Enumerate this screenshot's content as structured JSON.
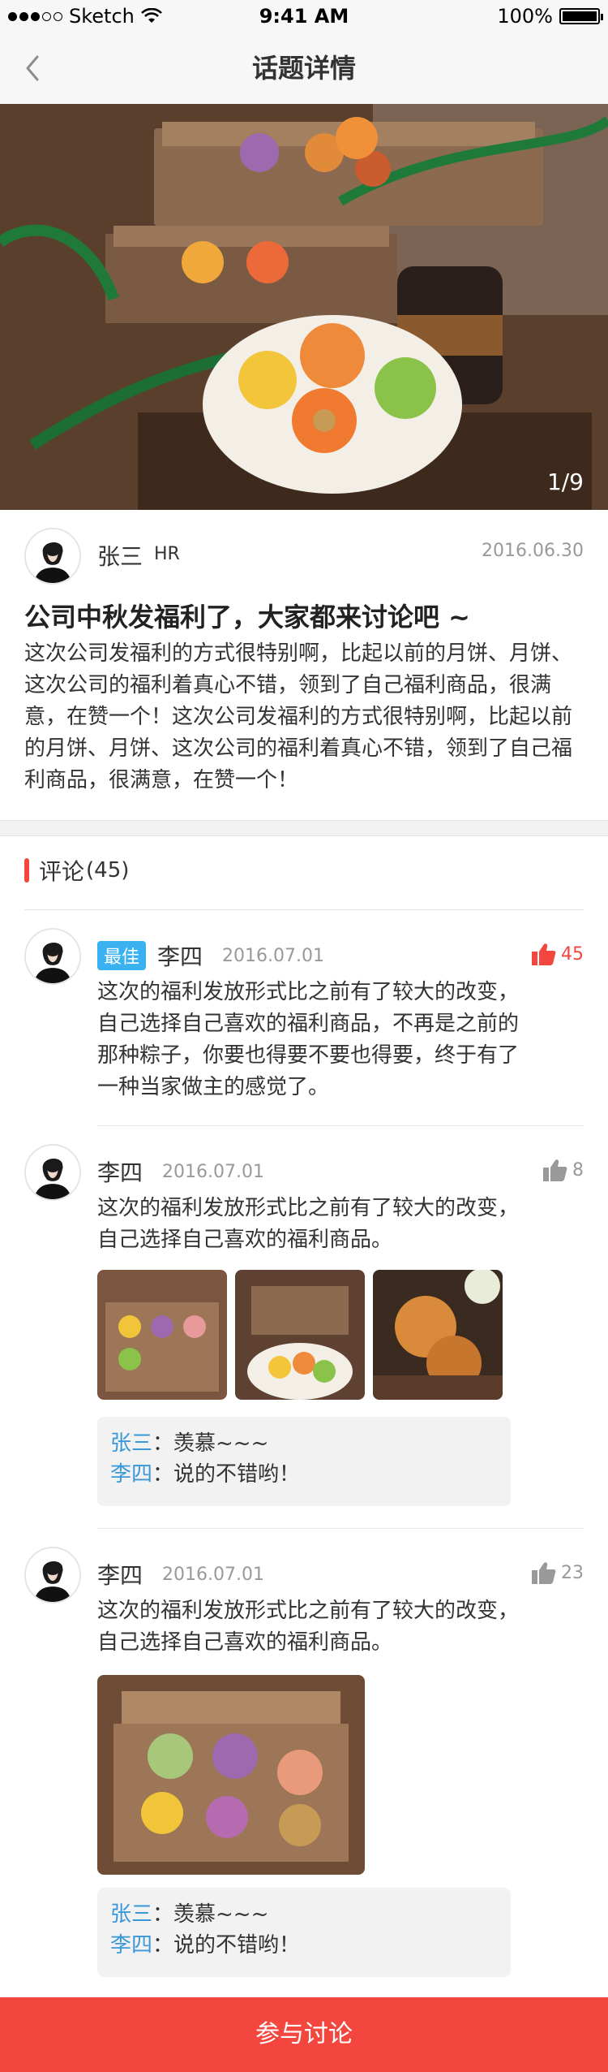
{
  "status_bar": {
    "carrier": "Sketch",
    "time": "9:41 AM",
    "battery": "100%"
  },
  "nav": {
    "title": "话题详情",
    "back_icon": "chevron-left-icon"
  },
  "hero": {
    "counter": "1/9"
  },
  "post": {
    "author": "张三",
    "role": "HR",
    "date": "2016.06.30",
    "title": "公司中秋发福利了，大家都来讨论吧 ~",
    "body": "这次公司发福利的方式很特别啊，比起以前的月饼、月饼、这次公司的福利着真心不错，领到了自己福利商品，很满意，在赞一个！这次公司发福利的方式很特别啊，比起以前的月饼、月饼、这次公司的福利着真心不错，领到了自己福利商品，很满意，在赞一个！"
  },
  "comments_section": {
    "title": "评论",
    "count": "(45)"
  },
  "comments": [
    {
      "badge": "最佳",
      "name": "李四",
      "date": "2016.07.01",
      "likes": "45",
      "text": "这次的福利发放形式比之前有了较大的改变，自己选择自己喜欢的福利商品，不再是之前的那种粽子，你要也得要不要也得要，终于有了一种当家做主的感觉了。"
    },
    {
      "name": "李四",
      "date": "2016.07.01",
      "likes": "8",
      "text": "这次的福利发放形式比之前有了较大的改变，自己选择自己喜欢的福利商品。",
      "replies": [
        {
          "user": "张三",
          "text": "：羡慕~~~"
        },
        {
          "user": "李四",
          "text": "：说的不错哟！"
        }
      ]
    },
    {
      "name": "李四",
      "date": "2016.07.01",
      "likes": "23",
      "text": "这次的福利发放形式比之前有了较大的改变，自己选择自己喜欢的福利商品。",
      "replies": [
        {
          "user": "张三",
          "text": "：羡慕~~~"
        },
        {
          "user": "李四",
          "text": "：说的不错哟！"
        }
      ]
    }
  ],
  "footer": {
    "join_label": "参与讨论"
  },
  "colors": {
    "accent": "#f2463f",
    "badge": "#3ab1f0",
    "reply_user": "#3a98d8"
  }
}
